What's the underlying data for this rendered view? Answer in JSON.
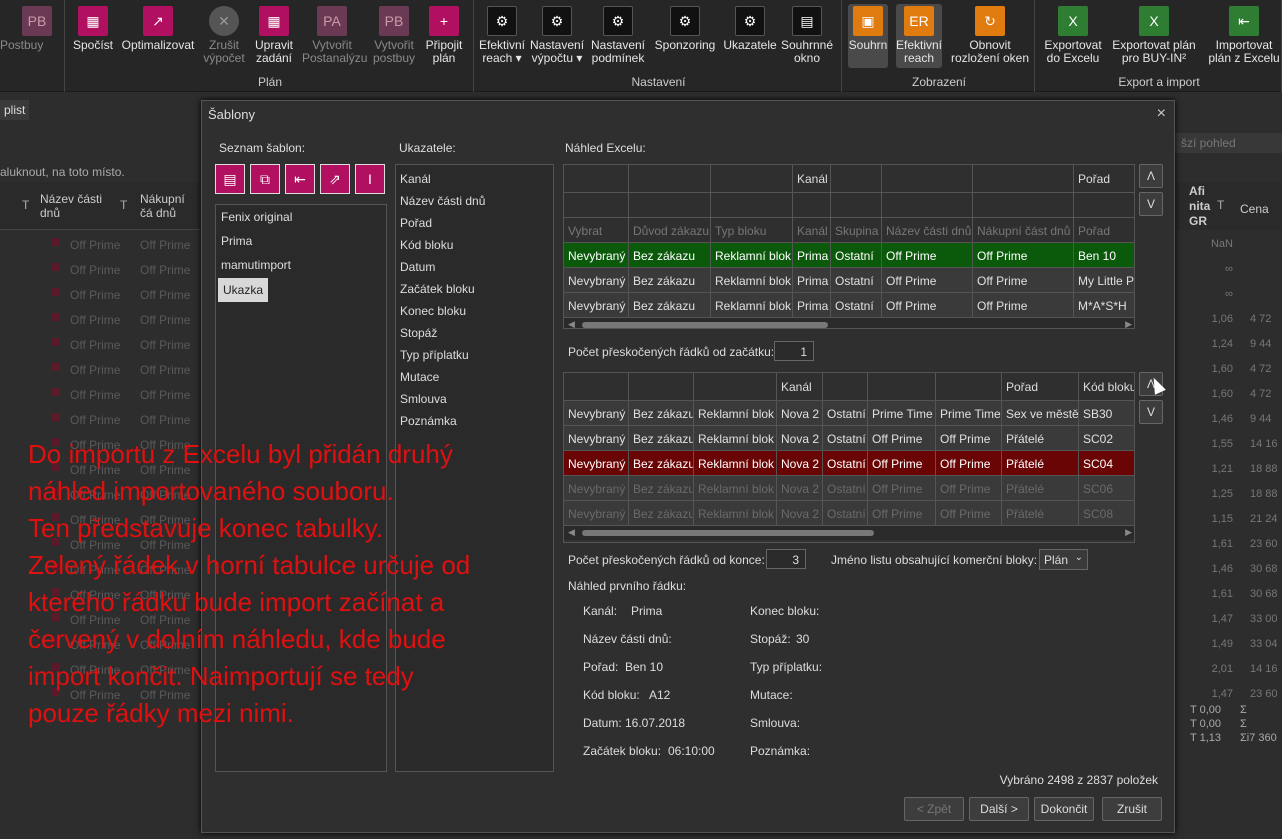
{
  "ribbon": {
    "buttons": [
      {
        "label": "Postbuy",
        "prefix": "a",
        "disabled": true
      },
      {
        "label": "Spočíst"
      },
      {
        "label": "Optimalizovat"
      },
      {
        "label": "Zrušit výpočet",
        "disabled": true
      },
      {
        "label": "Upravit zadání"
      },
      {
        "label": "Vytvořit Postanalýzu",
        "disabled": true
      },
      {
        "label": "Vytvořit postbuy",
        "disabled": true
      },
      {
        "label": "Připojit plán"
      },
      {
        "label": "Efektivní reach ▾"
      },
      {
        "label": "Nastavení výpočtu ▾"
      },
      {
        "label": "Nastavení podmínek"
      },
      {
        "label": "Sponzoring"
      },
      {
        "label": "Ukazatele"
      },
      {
        "label": "Souhrnné okno"
      },
      {
        "label": "Souhrn"
      },
      {
        "label": "Efektivní reach"
      },
      {
        "label": "Obnovit rozložení oken"
      },
      {
        "label": "Exportovat do Excelu"
      },
      {
        "label": "Exportovat plán pro BUY-IN²"
      },
      {
        "label": "Importovat plán z Excelu"
      }
    ],
    "icon_texts": {
      "pb": "PB",
      "pa": "PA",
      "er": "ER"
    },
    "groups": [
      "Plán",
      "Nastavení",
      "Zobrazení",
      "Export a import"
    ]
  },
  "background": {
    "tab": "plist",
    "hint": "aluknout, na toto místo.",
    "col_a": "Název části dnů",
    "col_b": "Nákupní čá dnů",
    "row_value": "Off Prime",
    "right_search": "šzí pohled",
    "right_cols": [
      "Afi nita GR",
      "Cena"
    ],
    "right_values": [
      "NaN",
      "∞",
      "∞",
      "1,06",
      "1,24",
      "1,60",
      "1,60",
      "1,46",
      "1,55",
      "1,21",
      "1,25",
      "1,15",
      "1,61",
      "1,46",
      "1,61",
      "1,47",
      "1,49",
      "2,01",
      "1,47"
    ],
    "right_prices": [
      "4 72",
      "9 44",
      "4 72",
      "4 72",
      "9 44",
      "14 16",
      "18 88",
      "18 88",
      "21 24",
      "23 60",
      "30 68",
      "30 68",
      "33 00",
      "33 04",
      "14 16",
      "23 60"
    ],
    "totals": [
      "T 0,00",
      "T 0,00",
      "T 1,13",
      "Σ",
      "Σ",
      "Σi7 360"
    ]
  },
  "dialog": {
    "title": "Šablony",
    "close": "×",
    "templates_label": "Seznam šablon:",
    "templates": [
      "Fenix original",
      "Prima",
      "mamutimport",
      "Ukazka"
    ],
    "selected_template": "Ukazka",
    "indicators_label": "Ukazatele:",
    "indicators": [
      "Kanál",
      "Název části dnů",
      "Pořad",
      "Kód bloku",
      "Datum",
      "Začátek bloku",
      "Konec bloku",
      "Stopáž",
      "Typ příplatku",
      "Mutace",
      "Smlouva",
      "Poznámka"
    ],
    "excel_preview_label": "Náhled Excelu:",
    "top_grid": {
      "header": [
        "",
        "",
        "",
        "Kanál",
        "",
        "",
        "",
        "Pořad"
      ],
      "placeholders": [
        "Vybrat",
        "Důvod zákazu",
        "Typ bloku",
        "Kanál",
        "Skupina",
        "Název části dnů",
        "Nákupní část dnů",
        "Pořad"
      ],
      "rows": [
        [
          "Nevybraný",
          "Bez zákazu",
          "Reklamní blok",
          "Prima",
          "Ostatní",
          "Off Prime",
          "Off Prime",
          "Ben 10"
        ],
        [
          "Nevybraný",
          "Bez zákazu",
          "Reklamní blok",
          "Prima",
          "Ostatní",
          "Off Prime",
          "Off Prime",
          "My Little P"
        ],
        [
          "Nevybraný",
          "Bez zákazu",
          "Reklamní blok",
          "Prima",
          "Ostatní",
          "Off Prime",
          "Off Prime",
          "M*A*S*H"
        ]
      ]
    },
    "skip_start_label": "Počet přeskočených řádků od začátku:",
    "skip_start_value": "1",
    "bottom_grid": {
      "header": [
        "",
        "",
        "",
        "Kanál",
        "",
        "",
        "",
        "Pořad",
        "Kód bloku"
      ],
      "rows": [
        [
          "Nevybraný",
          "Bez zákazu",
          "Reklamní blok",
          "Nova 2",
          "Ostatní",
          "Prime Time",
          "Prime Time",
          "Sex ve městě",
          "SB30"
        ],
        [
          "Nevybraný",
          "Bez zákazu",
          "Reklamní blok",
          "Nova 2",
          "Ostatní",
          "Off Prime",
          "Off Prime",
          "Přátelé",
          "SC02"
        ],
        [
          "Nevybraný",
          "Bez zákazu",
          "Reklamní blok",
          "Nova 2",
          "Ostatní",
          "Off Prime",
          "Off Prime",
          "Přátelé",
          "SC04"
        ],
        [
          "Nevybraný",
          "Bez zákazu",
          "Reklamní blok",
          "Nova 2",
          "Ostatní",
          "Off Prime",
          "Off Prime",
          "Přátelé",
          "SC06"
        ],
        [
          "Nevybraný",
          "Bez zákazu",
          "Reklamní blok",
          "Nova 2",
          "Ostatní",
          "Off Prime",
          "Off Prime",
          "Přátelé",
          "SC08"
        ]
      ]
    },
    "skip_end_label": "Počet přeskočených řádků od konce:",
    "skip_end_value": "3",
    "sheet_label": "Jméno listu obsahující komerční bloky:",
    "sheet_value": "Plán",
    "first_row_label": "Náhled prvního řádku:",
    "first_row_left": [
      {
        "k": "Kanál:",
        "v": "Prima"
      },
      {
        "k": "Název části dnů:",
        "v": ""
      },
      {
        "k": "Pořad:",
        "v": "Ben 10"
      },
      {
        "k": "Kód bloku:",
        "v": "A12"
      },
      {
        "k": "Datum:",
        "v": "16.07.2018"
      },
      {
        "k": "Začátek bloku:",
        "v": "06:10:00"
      }
    ],
    "first_row_right": [
      {
        "k": "Konec bloku:",
        "v": ""
      },
      {
        "k": "Stopáž:",
        "v": "30"
      },
      {
        "k": "Typ příplatku:",
        "v": ""
      },
      {
        "k": "Mutace:",
        "v": ""
      },
      {
        "k": "Smlouva:",
        "v": ""
      },
      {
        "k": "Poznámka:",
        "v": ""
      }
    ],
    "selected_summary": "Vybráno 2498 z 2837 položek",
    "buttons": {
      "back": "< Zpět",
      "next": "Další >",
      "finish": "Dokončit",
      "cancel": "Zrušit"
    },
    "up_arrow": "Λ",
    "down_arrow": "V"
  },
  "overlay_text": [
    "Do importu z Excelu byl přidán druhý",
    "náhled importovaného souboru.",
    "Ten představuje konec tabulky.",
    "Zelený řádek v horní tabulce určuje od",
    "kterého řádku bude import začínat a",
    "červený v dolním náhledu, kde bude",
    "import končit. Naimportují se tedy",
    "pouze řádky mezi nimi."
  ],
  "colors": {
    "accent": "#b0105f",
    "green_row": "#0b5a0b",
    "red_row": "#6a0505",
    "overlay": "#e01010"
  }
}
